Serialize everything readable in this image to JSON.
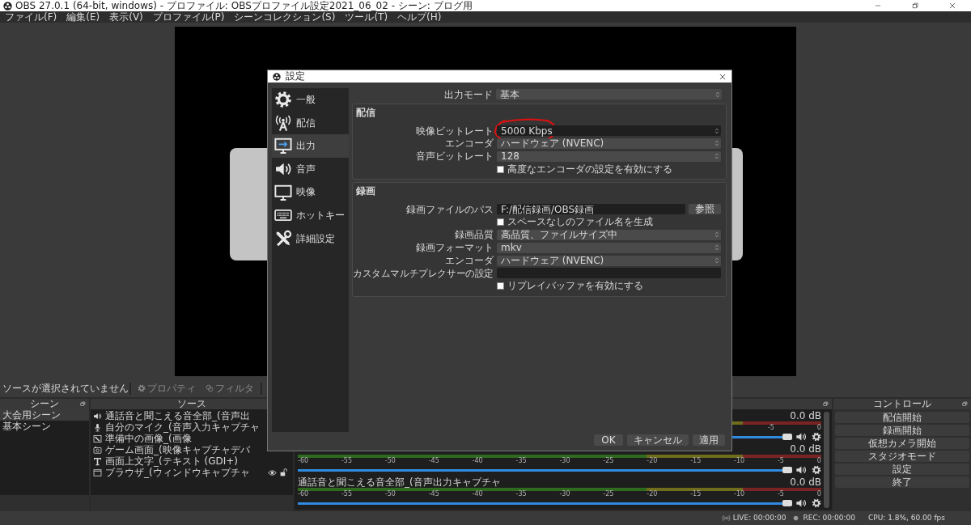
{
  "window": {
    "title": "OBS 27.0.1 (64-bit, windows) - プロファイル: OBSプロファイル設定2021_06_02 - シーン: ブログ用"
  },
  "menu": [
    "ファイル(F)",
    "編集(E)",
    "表示(V)",
    "プロファイル(P)",
    "シーンコレクション(S)",
    "ツール(T)",
    "ヘルプ(H)"
  ],
  "source_toolbar": {
    "status": "ソースが選択されていません",
    "buttons": [
      {
        "kind": "properties",
        "label": "プロパティ",
        "disabled": true
      },
      {
        "kind": "filters",
        "label": "フィルタ",
        "disabled": true
      }
    ]
  },
  "scenes": {
    "title": "シーン",
    "items": [
      {
        "label": "大会用シーン",
        "selected": true
      },
      {
        "label": "基本シーン",
        "selected": false
      }
    ]
  },
  "sources": {
    "title": "ソース",
    "items": [
      {
        "kind": "audio-output",
        "label": "通話音と聞こえる音全部_(音声出"
      },
      {
        "kind": "audio-input",
        "label": "自分のマイク_(音声入力キャプチャ"
      },
      {
        "kind": "image",
        "label": "準備中の画像_(画像"
      },
      {
        "kind": "video-capture",
        "label": "ゲーム画面_(映像キャプチャデバ"
      },
      {
        "kind": "text",
        "label": "画面上文字_(テキスト (GDI+)"
      },
      {
        "kind": "window-capture",
        "label": "ブラウザ_(ウィンドウキャプチャ",
        "visible": true,
        "locked": false
      }
    ]
  },
  "mixer": {
    "channels": [
      {
        "reading": "0.0 dB",
        "ticks": [
          "-5",
          "0"
        ],
        "level": 1,
        "muted": false
      },
      {
        "reading": "0.0 dB",
        "ticks": [
          "-60",
          "-55",
          "-50",
          "-45",
          "-40",
          "-35",
          "-30",
          "-25",
          "-20",
          "-15",
          "-10",
          "-5",
          "0"
        ],
        "level": 1,
        "muted": false
      },
      {
        "name": "通話音と聞こえる音全部_(音声出力キャプチャ",
        "reading": "0.0 dB",
        "ticks": [
          "-60",
          "-55",
          "-50",
          "-45",
          "-40",
          "-35",
          "-30",
          "-25",
          "-20",
          "-15",
          "-10",
          "-5",
          "0"
        ],
        "level": 1,
        "muted": false
      }
    ]
  },
  "controls": {
    "title": "コントロール",
    "buttons": [
      "配信開始",
      "録画開始",
      "仮想カメラ開始",
      "スタジオモード",
      "設定",
      "終了"
    ]
  },
  "status_bar": {
    "live": "LIVE: 00:00:00",
    "rec": "REC: 00:00:00",
    "cpu": "CPU: 1.8%, 60.00 fps"
  },
  "settings_dialog": {
    "title": "設定",
    "sidebar": [
      {
        "kind": "general",
        "label": "一般",
        "selected": false
      },
      {
        "kind": "stream",
        "label": "配信",
        "selected": false
      },
      {
        "kind": "output",
        "label": "出力",
        "selected": true
      },
      {
        "kind": "audio",
        "label": "音声",
        "selected": false
      },
      {
        "kind": "video",
        "label": "映像",
        "selected": false
      },
      {
        "kind": "hotkeys",
        "label": "ホットキー",
        "selected": false
      },
      {
        "kind": "advanced",
        "label": "詳細設定",
        "selected": false
      }
    ],
    "output_mode": {
      "label": "出力モード",
      "value": "基本"
    },
    "groups": [
      {
        "title": "配信",
        "rows": [
          {
            "kind": "spin",
            "label": "映像ビットレート",
            "value": "5000 Kbps"
          },
          {
            "kind": "select",
            "label": "エンコーダ",
            "value": "ハードウェア (NVENC)"
          },
          {
            "kind": "select",
            "label": "音声ビットレート",
            "value": "128"
          },
          {
            "kind": "checkbox",
            "label": "高度なエンコーダの設定を有効にする",
            "checked": false
          }
        ]
      },
      {
        "title": "録画",
        "rows": [
          {
            "kind": "path",
            "label": "録画ファイルのパス",
            "value": "F:/配信録画/OBS録画",
            "button": "参照"
          },
          {
            "kind": "checkbox",
            "label": "スペースなしのファイル名を生成",
            "checked": false
          },
          {
            "kind": "select",
            "label": "録画品質",
            "value": "高品質、ファイルサイズ中"
          },
          {
            "kind": "select",
            "label": "録画フォーマット",
            "value": "mkv"
          },
          {
            "kind": "select",
            "label": "エンコーダ",
            "value": "ハードウェア (NVENC)"
          },
          {
            "kind": "text",
            "label": "カスタムマルチプレクサーの設定"
          },
          {
            "kind": "checkbox",
            "label": "リプレイバッファを有効にする",
            "checked": false
          }
        ]
      }
    ],
    "buttons": [
      "OK",
      "キャンセル",
      "適用"
    ]
  }
}
